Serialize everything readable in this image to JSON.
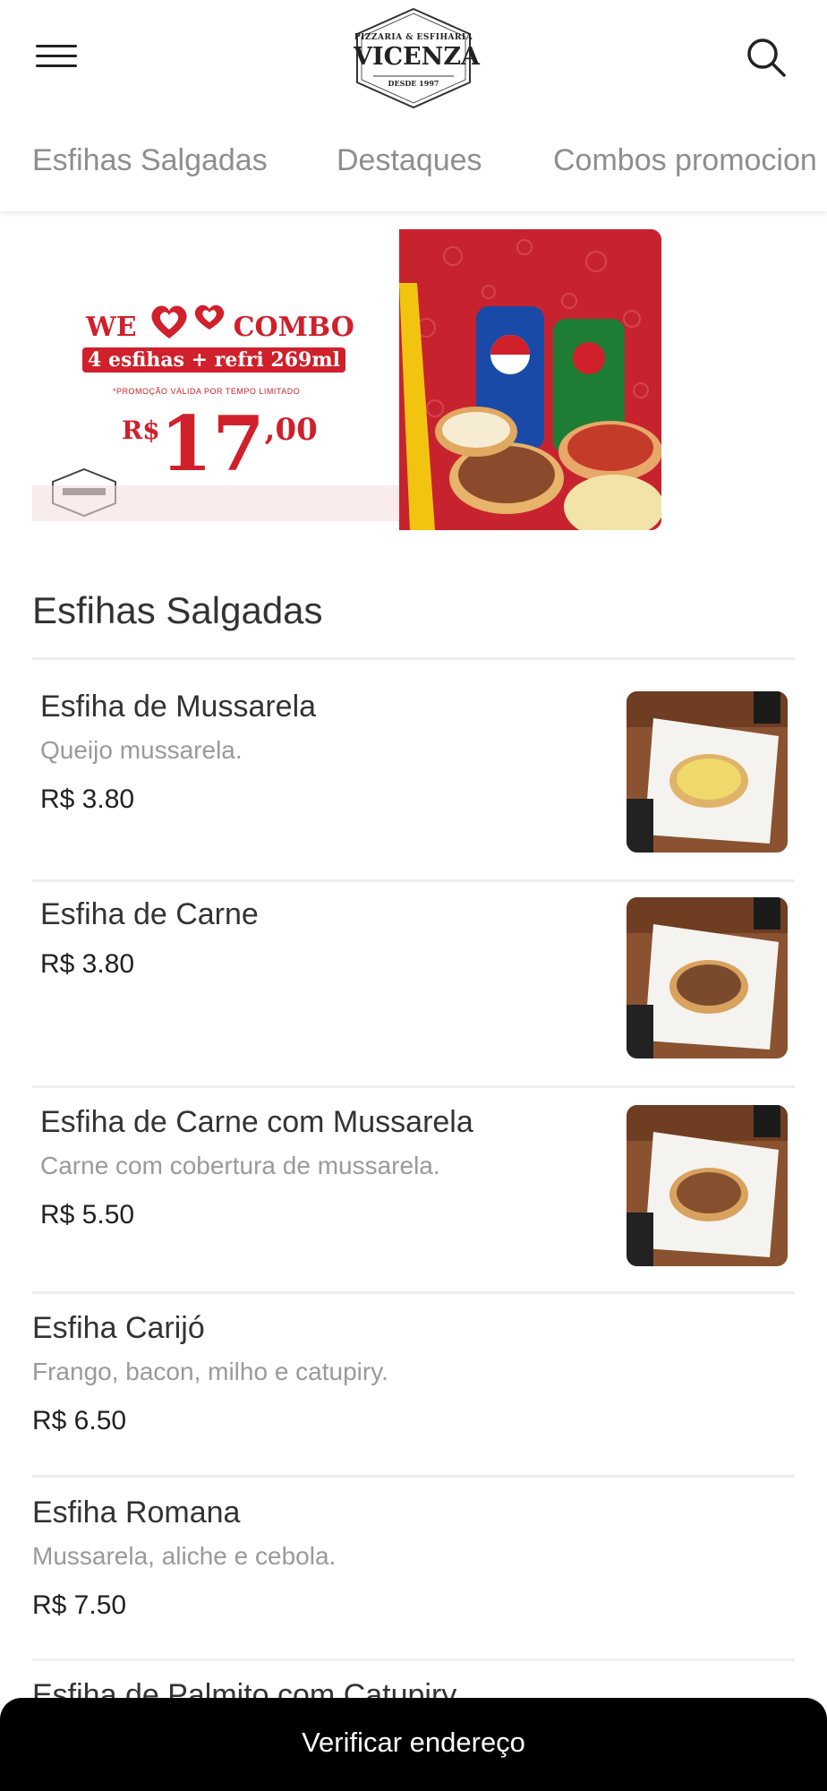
{
  "header": {
    "logo": {
      "top": "PIZZARIA & ESFIHARIA",
      "main": "VICENZA",
      "sub": "DESDE 1997"
    },
    "menu_icon": "hamburger-menu-icon",
    "search_icon": "search-icon"
  },
  "tabs": [
    {
      "label": "Esfihas Salgadas"
    },
    {
      "label": "Destaques"
    },
    {
      "label": "Combos promocion"
    }
  ],
  "banner": {
    "line1_we": "WE",
    "line1_combo": "COMBO",
    "line2": "4 esfihas + refri 269ml",
    "note": "*PROMOÇÃO VÁLIDA POR TEMPO LIMITADO",
    "currency": "R$",
    "price_int": "17",
    "price_cents": ",00",
    "colors": {
      "red": "#d0202b",
      "dark_red": "#c7232f",
      "yellow": "#f2c40f"
    }
  },
  "section": {
    "title": "Esfihas Salgadas"
  },
  "items": [
    {
      "name": "Esfiha de Mussarela",
      "description": "Queijo mussarela.",
      "price": "R$ 3.80"
    },
    {
      "name": "Esfiha de Carne",
      "description": "",
      "price": "R$ 3.80"
    },
    {
      "name": "Esfiha de Carne com Mussarela",
      "description": "Carne com cobertura de mussarela.",
      "price": "R$ 5.50"
    },
    {
      "name": "Esfiha Carijó",
      "description": "Frango, bacon, milho e catupiry.",
      "price": "R$ 6.50"
    },
    {
      "name": "Esfiha Romana",
      "description": "Mussarela, aliche e cebola.",
      "price": "R$ 7.50"
    },
    {
      "name": "Esfiha de Palmito com Catupiry"
    }
  ],
  "bottom_bar": {
    "label": "Verificar endereço"
  }
}
